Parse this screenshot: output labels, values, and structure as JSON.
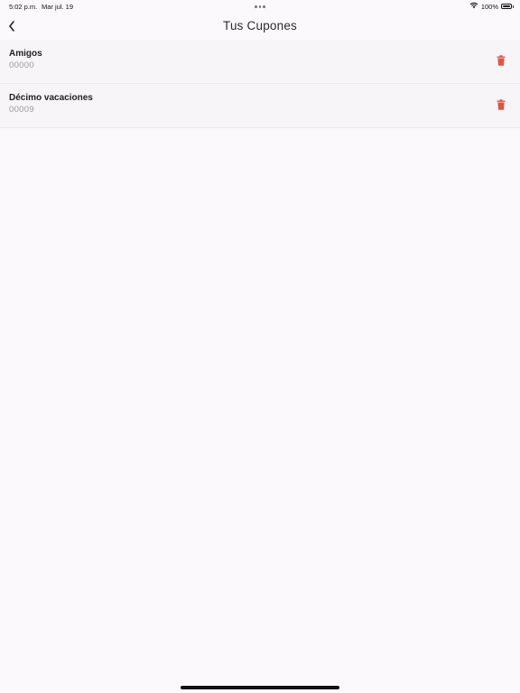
{
  "status_bar": {
    "time": "5:02 p.m.",
    "date": "Mar jul. 19",
    "battery_percent": "100%",
    "battery_level": 1.0,
    "wifi_icon": "wifi-icon",
    "battery_icon": "battery-icon"
  },
  "nav": {
    "title": "Tus Cupones",
    "back_icon": "chevron-left-icon"
  },
  "coupons": [
    {
      "name": "Amigos",
      "code": "00000"
    },
    {
      "name": "Décimo vacaciones",
      "code": "00009"
    }
  ],
  "colors": {
    "background": "#fbf9fc",
    "row_background": "#f7f5f8",
    "delete_red": "#e0553f",
    "code_gray": "#9a9a9a"
  },
  "delete_icon": "trash-icon"
}
